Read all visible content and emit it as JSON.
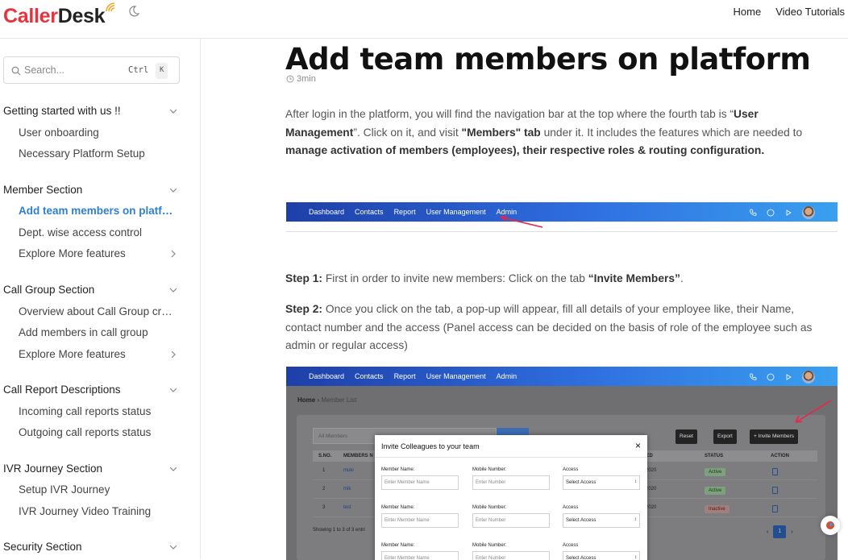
{
  "brand": {
    "part1": "Caller",
    "part2": "Desk"
  },
  "topnav": {
    "home": "Home",
    "video_tutorials": "Video Tutorials"
  },
  "search": {
    "placeholder": "Search...",
    "kbd_ctrl": "Ctrl",
    "kbd_k": "K"
  },
  "sidebar": {
    "sections": [
      {
        "title": "Getting started with us !!",
        "items": [
          "User onboarding",
          "Necessary Platform Setup"
        ]
      },
      {
        "title": "Member Section",
        "items": [
          "Add team members on platform",
          "Dept. wise access control",
          "Explore More features"
        ]
      },
      {
        "title": "Call Group Section",
        "items": [
          "Overview about Call Group creation",
          "Add members in call group",
          "Explore More features"
        ]
      },
      {
        "title": "Call Report Descriptions",
        "items": [
          "Incoming call reports status",
          "Outgoing call reports status"
        ]
      },
      {
        "title": "IVR Journey Section",
        "items": [
          "Setup IVR Journey",
          "IVR Journey Video Training"
        ]
      },
      {
        "title": "Security Section",
        "items": []
      }
    ]
  },
  "article": {
    "title": "Add team members on platform",
    "read_time": "3min",
    "intro": {
      "t1": "After login in the platform, you will find the navigation bar at the top where the fourth tab is “",
      "b1": "User Management",
      "t2": "”. Click on it, and visit ",
      "b2": "\"Members\" tab",
      "t3": " under it. It includes the features which are needed to ",
      "b3": "manage activation of members (employees), their respective roles & routing configuration."
    },
    "step1": {
      "label": "Step 1:",
      "t1": " First in order to invite new members: Click on the tab ",
      "b1": "“Invite Members”",
      "t2": "."
    },
    "step2": {
      "label": "Step 2:",
      "t1": " Once you click on the tab, a pop-up will appear, fill all details of your employee like, their Name, contact number and the access (Panel access can be decided on the basis of role of the employee such as admin or regular access)"
    }
  },
  "app_nav": {
    "items": [
      "Dashboard",
      "Contacts",
      "Report",
      "User Management",
      "Admin"
    ]
  },
  "screenshot": {
    "breadcrumb_home": "Home",
    "breadcrumb_page": "Member List",
    "filter_value": "All Members",
    "btn_reset": "Reset",
    "btn_export": "Export",
    "btn_invite": "+ Invite Members",
    "columns": [
      "S.NO.",
      "MEMBERS N",
      "ATED",
      "STATUS",
      "ACTION"
    ],
    "rows": [
      {
        "sno": "1",
        "name": "muki",
        "date": "ar 2020",
        "status": "Active"
      },
      {
        "sno": "2",
        "name": "mik",
        "date": "ar 2020",
        "status": "Active"
      },
      {
        "sno": "3",
        "name": "test",
        "date": "ar 2020",
        "status": "Inactive"
      }
    ],
    "showing": "Showing 1 to 3 of 3 entri",
    "page": "1",
    "modal": {
      "title": "Invite Colleagues to your team",
      "close": "×",
      "name_label": "Member Name:",
      "name_placeholder": "Enter Member Name",
      "mobile_label": "Mobile Number:",
      "mobile_placeholder": "Enter Number",
      "access_label": "Access",
      "access_value": "Select Access"
    }
  }
}
